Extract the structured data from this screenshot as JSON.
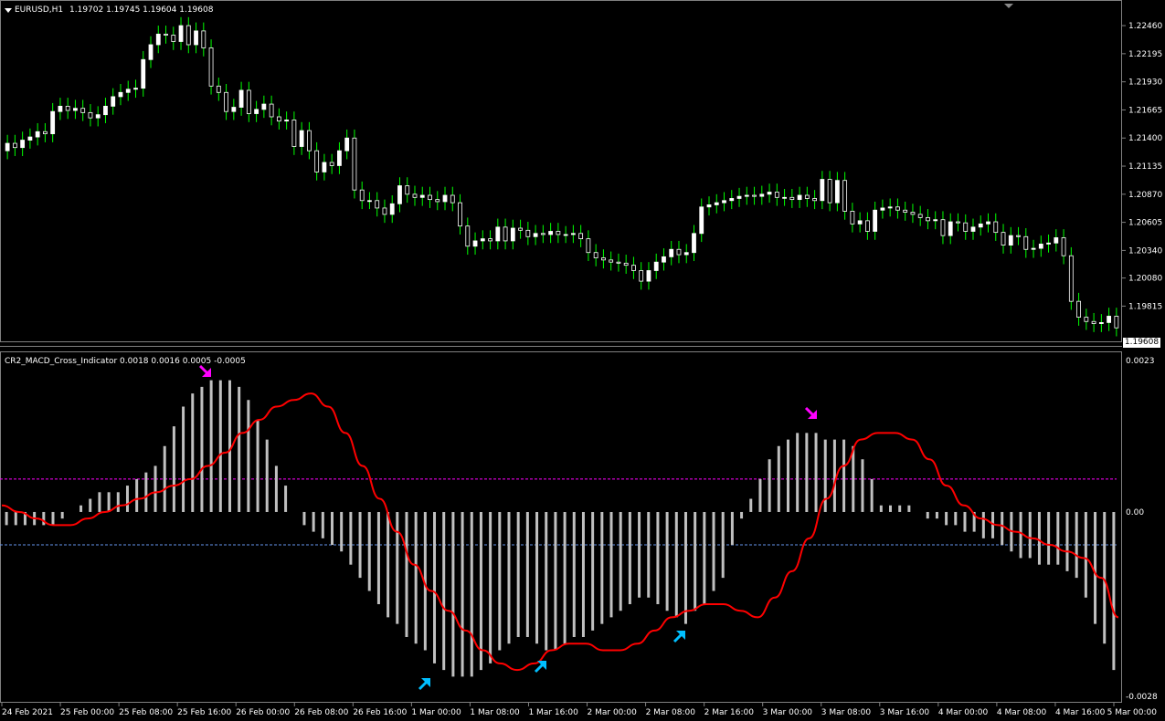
{
  "main_window": {
    "symbol_label": "EURUSD,H1",
    "ohlc": "1.19702 1.19745 1.19604 1.19608",
    "current_price": "1.19608",
    "price_ticks": [
      "1.22460",
      "1.22195",
      "1.21930",
      "1.21665",
      "1.21400",
      "1.21135",
      "1.20870",
      "1.20605",
      "1.20340",
      "1.20080",
      "1.19815"
    ]
  },
  "sub_window": {
    "indicator_label": "CR2_MACD_Cross_Indicator 0.0018 0.0016 0.0005 -0.0005",
    "ticks": [
      "0.0023",
      "0.00",
      "-0.0028"
    ],
    "levels": [
      0.0005,
      -0.0005
    ]
  },
  "time_axis": [
    "24 Feb 2021",
    "25 Feb 00:00",
    "25 Feb 08:00",
    "25 Feb 16:00",
    "26 Feb 00:00",
    "26 Feb 08:00",
    "26 Feb 16:00",
    "1 Mar 00:00",
    "1 Mar 08:00",
    "1 Mar 16:00",
    "2 Mar 00:00",
    "2 Mar 08:00",
    "2 Mar 16:00",
    "3 Mar 00:00",
    "3 Mar 08:00",
    "3 Mar 16:00",
    "4 Mar 00:00",
    "4 Mar 08:00",
    "4 Mar 16:00",
    "5 Mar 00:00"
  ],
  "colors": {
    "background": "#000000",
    "bull_candle": "#ffffff",
    "bear_candle": "#ffffff",
    "wick": "#00ff00",
    "histogram": "#c0c0c0",
    "signal_line": "#ff0000",
    "upper_level": "#ff00ff",
    "lower_level": "#6495ed",
    "sell_arrow": "#ff00ff",
    "buy_arrow": "#00bfff"
  },
  "chart_data": [
    {
      "type": "candlestick",
      "title": "EURUSD,H1",
      "ylim": [
        1.195,
        1.2265
      ],
      "close": [
        1.2135,
        1.2131,
        1.2138,
        1.2141,
        1.2146,
        1.2144,
        1.2165,
        1.217,
        1.2166,
        1.2168,
        1.2164,
        1.2159,
        1.2162,
        1.217,
        1.2179,
        1.2183,
        1.2186,
        1.2187,
        1.2214,
        1.2228,
        1.2238,
        1.2237,
        1.2231,
        1.2246,
        1.2228,
        1.2241,
        1.2225,
        1.2189,
        1.2183,
        1.2165,
        1.2169,
        1.2185,
        1.2163,
        1.2167,
        1.2172,
        1.216,
        1.2156,
        1.2157,
        1.2132,
        1.2147,
        1.2128,
        1.2108,
        1.2117,
        1.2114,
        1.2128,
        1.214,
        1.2091,
        1.2081,
        1.2081,
        1.2074,
        1.2068,
        1.2078,
        1.2095,
        1.2087,
        1.2084,
        1.2086,
        1.2082,
        1.208,
        1.2086,
        1.2079,
        1.2057,
        1.2038,
        1.2043,
        1.2045,
        1.2043,
        1.2056,
        1.2043,
        1.2055,
        1.2053,
        1.2047,
        1.205,
        1.2049,
        1.2052,
        1.2049,
        1.2049,
        1.205,
        1.2045,
        1.2032,
        1.2027,
        1.2025,
        1.2023,
        1.2022,
        1.202,
        1.2015,
        1.2005,
        1.2015,
        1.2023,
        1.2028,
        1.2035,
        1.203,
        1.2032,
        1.205,
        1.2075,
        1.2077,
        1.2079,
        1.2081,
        1.2083,
        1.2085,
        1.2086,
        1.2085,
        1.2087,
        1.2089,
        1.2084,
        1.2084,
        1.2082,
        1.2086,
        1.2083,
        1.2081,
        1.2101,
        1.2079,
        1.21,
        1.2071,
        1.2059,
        1.2062,
        1.2052,
        1.2072,
        1.2074,
        1.2075,
        1.2072,
        1.207,
        1.2068,
        1.2065,
        1.2062,
        1.2063,
        1.2048,
        1.2061,
        1.206,
        1.2052,
        1.2056,
        1.2059,
        1.2061,
        1.2051,
        1.2039,
        1.2048,
        1.2047,
        1.2035,
        1.2036,
        1.204,
        1.2041,
        1.2046,
        1.2029,
        1.1986,
        1.1971,
        1.1967,
        1.1965,
        1.1966,
        1.1972,
        1.1961
      ],
      "open": [
        1.2128,
        1.2135,
        1.2131,
        1.2138,
        1.2141,
        1.2146,
        1.2144,
        1.2165,
        1.217,
        1.2166,
        1.2168,
        1.2164,
        1.2159,
        1.2162,
        1.217,
        1.2179,
        1.2183,
        1.2186,
        1.2187,
        1.2214,
        1.2228,
        1.2238,
        1.2237,
        1.2231,
        1.2246,
        1.2228,
        1.2241,
        1.2225,
        1.2189,
        1.2183,
        1.2165,
        1.2169,
        1.2185,
        1.2163,
        1.2167,
        1.2172,
        1.216,
        1.2156,
        1.2157,
        1.2132,
        1.2147,
        1.2128,
        1.2108,
        1.2117,
        1.2114,
        1.2128,
        1.214,
        1.2091,
        1.2081,
        1.2081,
        1.2074,
        1.2068,
        1.2078,
        1.2095,
        1.2087,
        1.2084,
        1.2086,
        1.2082,
        1.208,
        1.2086,
        1.2079,
        1.2057,
        1.2038,
        1.2043,
        1.2045,
        1.2043,
        1.2056,
        1.2043,
        1.2055,
        1.2053,
        1.2047,
        1.205,
        1.2049,
        1.2052,
        1.2049,
        1.2049,
        1.205,
        1.2045,
        1.2032,
        1.2027,
        1.2025,
        1.2023,
        1.2022,
        1.202,
        1.2015,
        1.2005,
        1.2015,
        1.2023,
        1.2028,
        1.2035,
        1.203,
        1.2032,
        1.205,
        1.2075,
        1.2077,
        1.2079,
        1.2081,
        1.2083,
        1.2085,
        1.2086,
        1.2085,
        1.2087,
        1.2089,
        1.2084,
        1.2084,
        1.2082,
        1.2086,
        1.2083,
        1.2081,
        1.2101,
        1.2079,
        1.21,
        1.2071,
        1.2059,
        1.2062,
        1.2052,
        1.2072,
        1.2074,
        1.2075,
        1.2072,
        1.207,
        1.2068,
        1.2065,
        1.2062,
        1.2063,
        1.2048,
        1.2061,
        1.206,
        1.2052,
        1.2056,
        1.2059,
        1.2061,
        1.2051,
        1.2039,
        1.2048,
        1.2047,
        1.2035,
        1.2036,
        1.204,
        1.2041,
        1.2046,
        1.2029,
        1.1986,
        1.1971,
        1.1967,
        1.1965,
        1.1966,
        1.1972
      ]
    },
    {
      "type": "bar",
      "title": "CR2_MACD_Cross_Indicator",
      "ylim": [
        -0.0028,
        0.0023
      ],
      "histogram": [
        -0.0002,
        -0.0002,
        -0.0002,
        -0.0002,
        -0.0002,
        -0.0002,
        -0.0001,
        0.0,
        0.0001,
        0.0002,
        0.0003,
        0.0003,
        0.0003,
        0.0004,
        0.0005,
        0.0006,
        0.0007,
        0.001,
        0.0013,
        0.0016,
        0.0018,
        0.0019,
        0.002,
        0.002,
        0.002,
        0.0019,
        0.0017,
        0.0014,
        0.0011,
        0.0007,
        0.0004,
        0.0,
        -0.0002,
        -0.0003,
        -0.0004,
        -0.0005,
        -0.0006,
        -0.0008,
        -0.001,
        -0.0012,
        -0.0014,
        -0.0016,
        -0.0017,
        -0.0019,
        -0.002,
        -0.0021,
        -0.0023,
        -0.0024,
        -0.0025,
        -0.0025,
        -0.0025,
        -0.0024,
        -0.0023,
        -0.0021,
        -0.002,
        -0.0019,
        -0.0019,
        -0.002,
        -0.0021,
        -0.0021,
        -0.002,
        -0.0019,
        -0.0019,
        -0.0018,
        -0.0017,
        -0.0016,
        -0.0015,
        -0.0014,
        -0.0013,
        -0.0013,
        -0.0014,
        -0.0015,
        -0.0016,
        -0.0017,
        -0.0015,
        -0.0014,
        -0.0012,
        -0.001,
        -0.0005,
        -0.0001,
        0.0002,
        0.0005,
        0.0008,
        0.001,
        0.0011,
        0.0012,
        0.0012,
        0.0012,
        0.0011,
        0.0011,
        0.0011,
        0.001,
        0.0008,
        0.0005,
        0.0001,
        0.0001,
        0.0001,
        0.0001,
        0.0,
        -0.0001,
        -0.0001,
        -0.0002,
        -0.0002,
        -0.0003,
        -0.0003,
        -0.0004,
        -0.0004,
        -0.0005,
        -0.0006,
        -0.0007,
        -0.0007,
        -0.0008,
        -0.0008,
        -0.0008,
        -0.0009,
        -0.001,
        -0.0013,
        -0.0017,
        -0.002,
        -0.0024
      ],
      "signal": [
        0.0001,
        0.0,
        -0.0001,
        -0.0002,
        -0.0002,
        -0.0001,
        0.0,
        0.0001,
        0.0002,
        0.0003,
        0.0004,
        0.0005,
        0.0007,
        0.0009,
        0.0012,
        0.0014,
        0.0016,
        0.0017,
        0.0018,
        0.0016,
        0.0012,
        0.0007,
        0.0002,
        -0.0003,
        -0.0008,
        -0.0012,
        -0.0015,
        -0.0018,
        -0.0021,
        -0.0023,
        -0.0024,
        -0.0023,
        -0.0021,
        -0.002,
        -0.002,
        -0.0021,
        -0.0021,
        -0.002,
        -0.0018,
        -0.0016,
        -0.0015,
        -0.0014,
        -0.0014,
        -0.0015,
        -0.0016,
        -0.0013,
        -0.0009,
        -0.0004,
        0.0002,
        0.0007,
        0.0011,
        0.0012,
        0.0012,
        0.0011,
        0.0008,
        0.0004,
        0.0001,
        -0.0001,
        -0.0002,
        -0.0003,
        -0.0004,
        -0.0005,
        -0.0006,
        -0.0007,
        -0.001,
        -0.0016
      ],
      "signal_x": [
        0,
        2,
        4,
        6,
        8,
        10,
        12,
        14,
        16,
        18,
        20,
        22,
        24,
        26,
        28,
        30,
        32,
        34,
        36,
        38,
        40,
        42,
        44,
        46,
        48,
        50,
        52,
        54,
        56,
        58,
        60,
        62,
        64,
        66,
        68,
        70,
        72,
        74,
        76,
        78,
        80,
        82,
        84,
        86,
        88,
        90,
        92,
        94,
        96,
        98,
        100,
        102,
        104,
        106,
        108,
        110,
        112,
        114,
        116,
        118,
        120,
        122,
        124,
        126,
        128,
        130
      ],
      "levels": [
        0.0005,
        -0.0005
      ]
    }
  ]
}
